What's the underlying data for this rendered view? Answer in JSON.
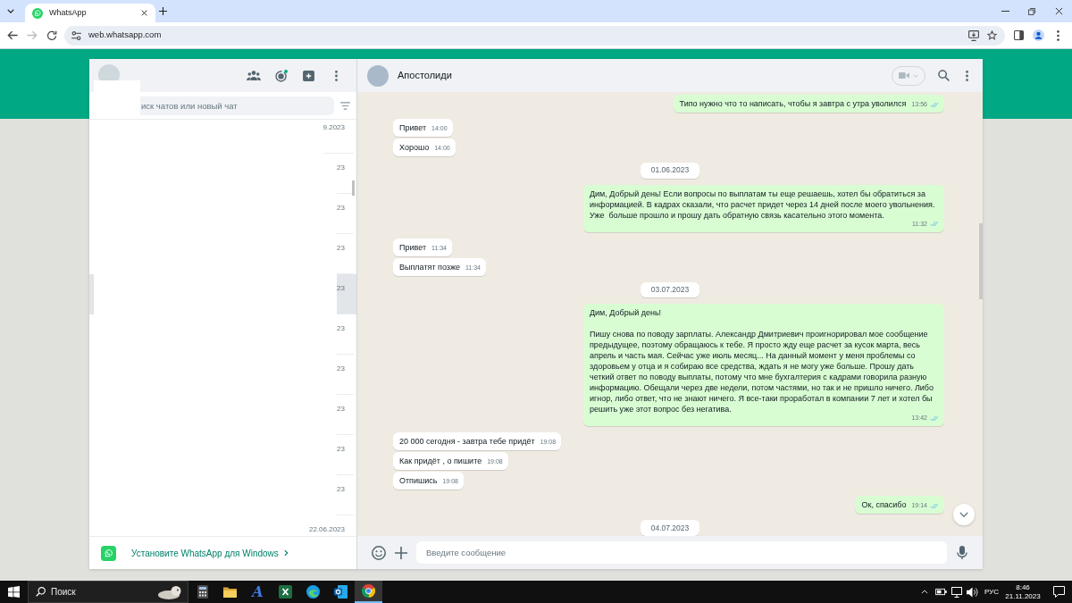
{
  "browser": {
    "tabs": [
      {
        "title": "WhatsApp",
        "selected": true
      }
    ],
    "forward_disabled": true,
    "address": "web.whatsapp.com"
  },
  "sidebar": {
    "search": {
      "placeholder": "иск чатов или новый чат"
    },
    "chats": [
      {
        "date": "9.2023",
        "selected": false
      },
      {
        "date": "23",
        "selected": false
      },
      {
        "date": "23",
        "selected": false
      },
      {
        "date": "23",
        "selected": false
      },
      {
        "date": "23",
        "selected": true
      },
      {
        "date": "23",
        "selected": false
      },
      {
        "date": "23",
        "selected": false
      },
      {
        "date": "23",
        "selected": false
      },
      {
        "date": "23",
        "selected": false
      },
      {
        "date": "23",
        "selected": false
      },
      {
        "date": "22.06.2023",
        "selected": false
      }
    ],
    "install_banner": {
      "text": "Установите WhatsApp для Windows"
    }
  },
  "chat": {
    "contact": {
      "name": "Апостолиди"
    },
    "messages": [
      {
        "kind": "outgoing",
        "text": "Типо нужно что то написать, чтобы я завтра с утра уволился",
        "time": "13:56",
        "read": true
      },
      {
        "kind": "incoming",
        "text": "Привет",
        "time": "14:00"
      },
      {
        "kind": "incoming",
        "text": "Хорошо",
        "time": "14:00"
      },
      {
        "kind": "date",
        "text": "01.06.2023"
      },
      {
        "kind": "outgoing",
        "text": "Дим, Добрый день! Если вопросы по выплатам ты еще решаешь, хотел бы обратиться за информацией. В кадрах сказали, что расчет придет через 14 дней после моего увольнения. Уже  больше прошло и прошу дать обратную связь касательно этого момента.",
        "time": "11:32",
        "read": true
      },
      {
        "kind": "incoming",
        "text": "Привет",
        "time": "11:34"
      },
      {
        "kind": "incoming",
        "text": "Выплатят позже",
        "time": "11:34"
      },
      {
        "kind": "date",
        "text": "03.07.2023"
      },
      {
        "kind": "outgoing",
        "text": "Дим, Добрый день!\n\nПишу снова по поводу зарплаты. Александр Дмитриевич проигнорировал мое сообщение предыдущее, поэтому обращаюсь к тебе. Я просто жду еще расчет за кусок марта, весь апрель и часть мая. Сейчас уже июль месяц... На данный момент у меня проблемы со здоровьем у отца и я собираю все средства, ждать я не могу уже больше. Прошу дать четкий ответ по поводу выплаты, потому что мне бухгалтерия с кадрами говорила разную информацию. Обещали через две недели, потом частями, но так и не пришло ничего. Либо игнор, либо ответ, что не знают ничего. Я все-таки проработал в компании 7 лет и хотел бы решить уже этот вопрос без негатива.",
        "time": "13:42",
        "read": true
      },
      {
        "kind": "incoming",
        "text": "20 000 сегодня - завтра тебе придёт",
        "time": "19:08"
      },
      {
        "kind": "incoming",
        "text": "Как придёт , о пишите",
        "time": "19:08"
      },
      {
        "kind": "incoming",
        "text": "Отпишись",
        "time": "19:08"
      },
      {
        "kind": "outgoing",
        "text": "Ок, спасибо",
        "time": "19:14",
        "read": true
      },
      {
        "kind": "date",
        "text": "04.07.2023"
      }
    ],
    "composer": {
      "placeholder": "Введите сообщение"
    }
  },
  "taskbar": {
    "search": {
      "placeholder": "Поиск"
    },
    "apps": [
      {
        "kind": "calculator",
        "active": false
      },
      {
        "kind": "folder",
        "active": false
      },
      {
        "kind": "letter",
        "glyph": "A",
        "active": false
      },
      {
        "kind": "spreadsheet",
        "active": false
      },
      {
        "kind": "swirl",
        "active": false
      },
      {
        "kind": "mail",
        "active": false
      },
      {
        "kind": "browser",
        "active": true
      }
    ],
    "language": "РУС",
    "time": "8:46",
    "date": "21.11.2023"
  }
}
